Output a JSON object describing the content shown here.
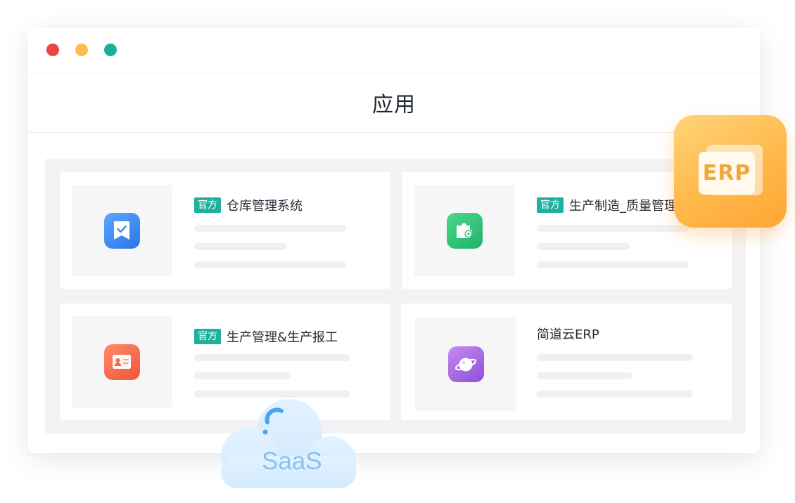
{
  "window": {
    "controls": [
      "close",
      "minimize",
      "maximize"
    ],
    "colors": {
      "close": "#e84545",
      "minimize": "#fbbd50",
      "maximize": "#1ab09a"
    }
  },
  "page": {
    "title": "应用"
  },
  "cards": [
    {
      "tag": "官方",
      "name": "仓库管理系统",
      "icon": "checklist-bookmark-icon",
      "icon_color": "#3d8cf5"
    },
    {
      "tag": "官方",
      "name": "生产制造_质量管理",
      "icon": "puzzle-gear-icon",
      "icon_color": "#2cc379"
    },
    {
      "tag": "官方",
      "name": "生产管理&生产报工",
      "icon": "id-card-icon",
      "icon_color": "#f5684a"
    },
    {
      "tag": "",
      "name": "简道云ERP",
      "icon": "planet-icon",
      "icon_color": "#a968e3"
    }
  ],
  "badges": {
    "erp": "ERP",
    "saas": "SaaS"
  },
  "colors": {
    "tag": "#1fb19e",
    "erp": "#ffb84a",
    "saas": "#86c2f2"
  }
}
